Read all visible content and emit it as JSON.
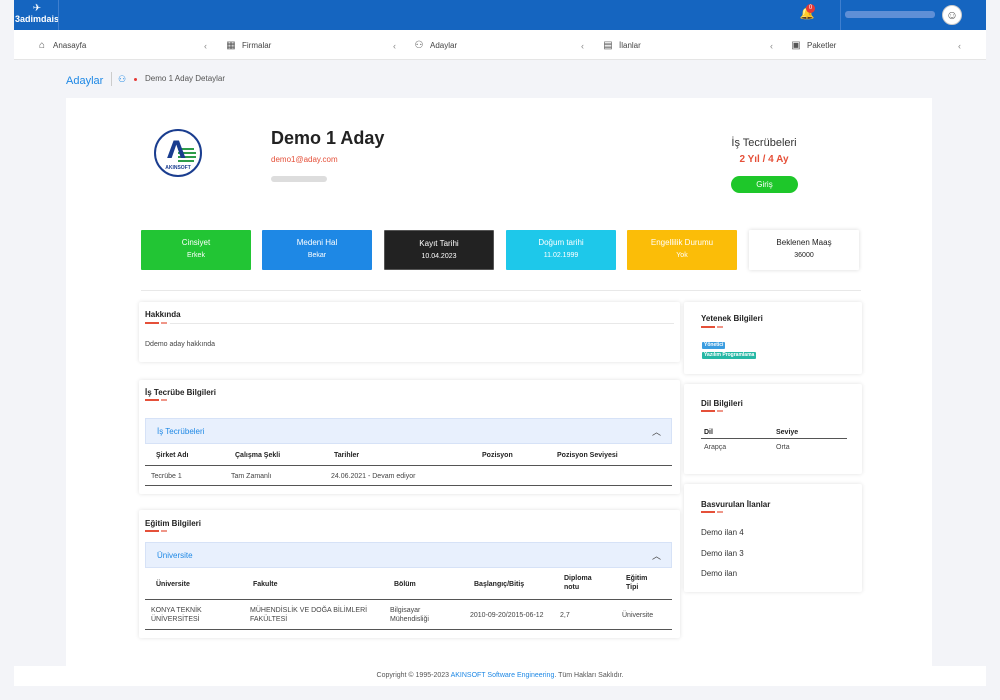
{
  "app": {
    "logo_text": "3adimdais"
  },
  "topbar": {
    "notification_count": "0"
  },
  "nav": {
    "items": [
      {
        "label": "Anasayfa",
        "icon": "home-icon"
      },
      {
        "label": "Firmalar",
        "icon": "table-icon"
      },
      {
        "label": "Adaylar",
        "icon": "user-icon"
      },
      {
        "label": "İlanlar",
        "icon": "document-icon"
      },
      {
        "label": "Paketler",
        "icon": "package-icon"
      }
    ],
    "chevron": "‹"
  },
  "breadcrumb": {
    "section": "Adaylar",
    "current": "Demo 1 Aday Detaylar"
  },
  "company": {
    "logo_text": "AKINSOFT"
  },
  "profile": {
    "name": "Demo 1 Aday",
    "email": "demo1@aday.com"
  },
  "experience": {
    "title": "İş Tecrübeleri",
    "value": "2 Yıl / 4 Ay",
    "button_label": "Giriş"
  },
  "stats": [
    {
      "label": "Cinsiyet",
      "value": "Erkek",
      "color": "#22c534",
      "text_color": "#ffffff"
    },
    {
      "label": "Medeni Hal",
      "value": "Bekar",
      "color": "#1e88e5",
      "text_color": "#ffffff"
    },
    {
      "label": "Kayıt Tarihi",
      "value": "10.04.2023",
      "color": "#222222",
      "text_color": "#ffffff"
    },
    {
      "label": "Doğum tarihi",
      "value": "11.02.1999",
      "color": "#1ec8ea",
      "text_color": "#ffffff"
    },
    {
      "label": "Engellilik Durumu",
      "value": "Yok",
      "color": "#fbbd08",
      "text_color": "#ffffff"
    },
    {
      "label": "Beklenen Maaş",
      "value": "36000",
      "color": "#ffffff",
      "text_color": "#222222"
    }
  ],
  "about": {
    "title": "Hakkında",
    "text": "Ddemo aday hakkında"
  },
  "work": {
    "title": "İş Tecrübe Bilgileri",
    "accordion_label": "İş Tecrübeleri",
    "chevron": "︿",
    "columns": [
      "Şirket Adı",
      "Çalışma Şekli",
      "Tarihler",
      "Pozisyon",
      "Pozisyon Seviyesi"
    ],
    "rows": [
      [
        "Tecrübe 1",
        "Tam Zamanlı",
        "24.06.2021 - Devam ediyor",
        "",
        ""
      ]
    ]
  },
  "education": {
    "title": "Eğitim Bilgileri",
    "accordion_label": "Üniversite",
    "chevron": "︿",
    "columns": [
      "Üniversite",
      "Fakulte",
      "Bölüm",
      "Başlangıç/Bitiş",
      "Diploma notu",
      "Eğitim Tipi"
    ],
    "rows": [
      [
        "KONYA TEKNİK ÜNİVERSİTESİ",
        "MÜHENDİSLİK VE DOĞA BİLİMLERİ FAKÜLTESİ",
        "Bilgisayar Mühendisliği",
        "2010-09-20/2015-06-12",
        "2,7",
        "Üniversite"
      ]
    ]
  },
  "skills": {
    "title": "Yetenek Bilgileri",
    "badges": [
      {
        "label": "Yönetici",
        "color": "#3b9de0"
      },
      {
        "label": "Yazılım Programlama",
        "color": "#26b8a5"
      }
    ]
  },
  "languages": {
    "title": "Dil Bilgileri",
    "columns": [
      "Dil",
      "Seviye"
    ],
    "rows": [
      [
        "Arapça",
        "Orta"
      ]
    ]
  },
  "applications": {
    "title": "Basvurulan İlanlar",
    "items": [
      "Demo ilan 4",
      "Demo ilan 3",
      "Demo ilan"
    ]
  },
  "footer": {
    "prefix": "Copyright © 1995-2023 ",
    "link": "AKINSOFT Software Engineering",
    "suffix": ". Tüm Hakları Saklıdır."
  }
}
